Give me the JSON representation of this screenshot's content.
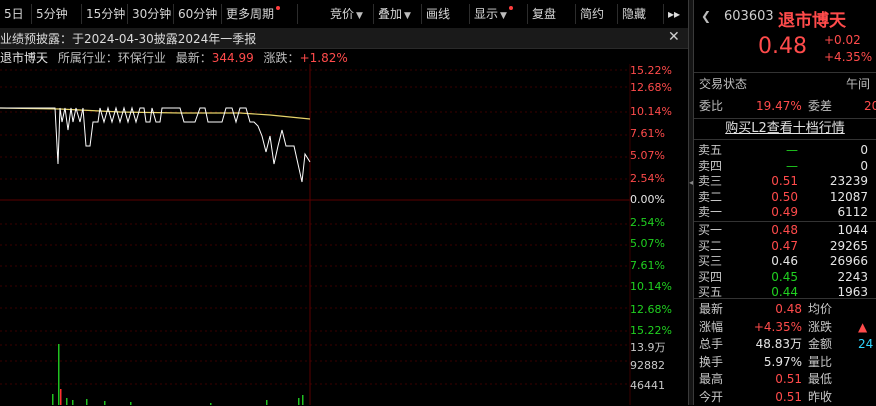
{
  "toolbar": {
    "items": [
      {
        "label": "5日",
        "dot": false,
        "caret": false
      },
      {
        "label": "5分钟",
        "dot": false,
        "caret": false
      },
      {
        "label": "15分钟",
        "dot": false,
        "caret": false
      },
      {
        "label": "30分钟",
        "dot": false,
        "caret": false
      },
      {
        "label": "60分钟",
        "dot": false,
        "caret": false
      },
      {
        "label": "更多周期",
        "dot": true,
        "caret": false
      },
      {
        "label": "竞价",
        "dot": false,
        "caret": true
      },
      {
        "label": "叠加",
        "dot": false,
        "caret": true
      },
      {
        "label": "画线",
        "dot": false,
        "caret": false
      },
      {
        "label": "显示",
        "dot": true,
        "caret": true
      },
      {
        "label": "复盘",
        "dot": false,
        "caret": false
      },
      {
        "label": "简约",
        "dot": false,
        "caret": false
      },
      {
        "label": "隐藏",
        "dot": false,
        "caret": false
      }
    ],
    "more_arrows": "▸▸"
  },
  "notice": {
    "text": "业绩预披露：于2024-04-30披露2024年一季报",
    "close": "✕"
  },
  "info": {
    "name": "退市博天",
    "industry_label": "所属行业：",
    "industry": "环保行业",
    "latest_label": "最新：",
    "latest": "344.99",
    "change_label": "涨跌：",
    "change": "+1.82%"
  },
  "chart": {
    "price_labels_up": [
      "15.22%",
      "12.68%",
      "10.14%",
      "7.61%",
      "5.07%",
      "2.54%"
    ],
    "zero_label": "0.00%",
    "price_labels_down": [
      "2.54%",
      "5.07%",
      "7.61%",
      "10.14%",
      "12.68%",
      "15.22%"
    ],
    "volume_labels": [
      "13.9万",
      "92882",
      "46441"
    ],
    "colors": {
      "price_line": "#ffffff",
      "avg_line": "#e6d36a",
      "volume_bar": "#20c020",
      "volume_bar_up": "#ff3030",
      "grid": "#3a0000"
    }
  },
  "panel": {
    "code": "603603",
    "name": "退市博天",
    "price": "0.48",
    "change": "+0.02",
    "change_pct": "+4.35%",
    "status_label": "交易状态",
    "status_value": "午间",
    "wb_label": "委比",
    "wb_value": "19.47%",
    "wc_label": "委差",
    "wc_value": "20",
    "l2_button": "购买L2查看十档行情",
    "sells": [
      {
        "label": "卖五",
        "price": "—",
        "vol": "0",
        "color": "green"
      },
      {
        "label": "卖四",
        "price": "—",
        "vol": "0",
        "color": "green"
      },
      {
        "label": "卖三",
        "price": "0.51",
        "vol": "23239",
        "color": "red"
      },
      {
        "label": "卖二",
        "price": "0.50",
        "vol": "12087",
        "color": "red"
      },
      {
        "label": "卖一",
        "price": "0.49",
        "vol": "6112",
        "color": "red"
      }
    ],
    "buys": [
      {
        "label": "买一",
        "price": "0.48",
        "vol": "1044",
        "color": "red"
      },
      {
        "label": "买二",
        "price": "0.47",
        "vol": "29265",
        "color": "red"
      },
      {
        "label": "买三",
        "price": "0.46",
        "vol": "26966",
        "color": "white"
      },
      {
        "label": "买四",
        "price": "0.45",
        "vol": "2243",
        "color": "green"
      },
      {
        "label": "买五",
        "price": "0.44",
        "vol": "1963",
        "color": "green"
      }
    ],
    "stats": [
      {
        "l1": "最新",
        "v1": "0.48",
        "c1": "red",
        "l2": "均价",
        "v2": "",
        "c2": "white"
      },
      {
        "l1": "涨幅",
        "v1": "+4.35%",
        "c1": "red",
        "l2": "涨跌",
        "v2": "▲",
        "c2": "red"
      },
      {
        "l1": "总手",
        "v1": "48.83万",
        "c1": "white",
        "l2": "金额",
        "v2": "24",
        "c2": "cyan"
      },
      {
        "l1": "换手",
        "v1": "5.97%",
        "c1": "white",
        "l2": "量比",
        "v2": "",
        "c2": "white"
      },
      {
        "l1": "最高",
        "v1": "0.51",
        "c1": "red",
        "l2": "最低",
        "v2": "",
        "c2": "white"
      },
      {
        "l1": "今开",
        "v1": "0.51",
        "c1": "red",
        "l2": "昨收",
        "v2": "",
        "c2": "white"
      }
    ]
  }
}
